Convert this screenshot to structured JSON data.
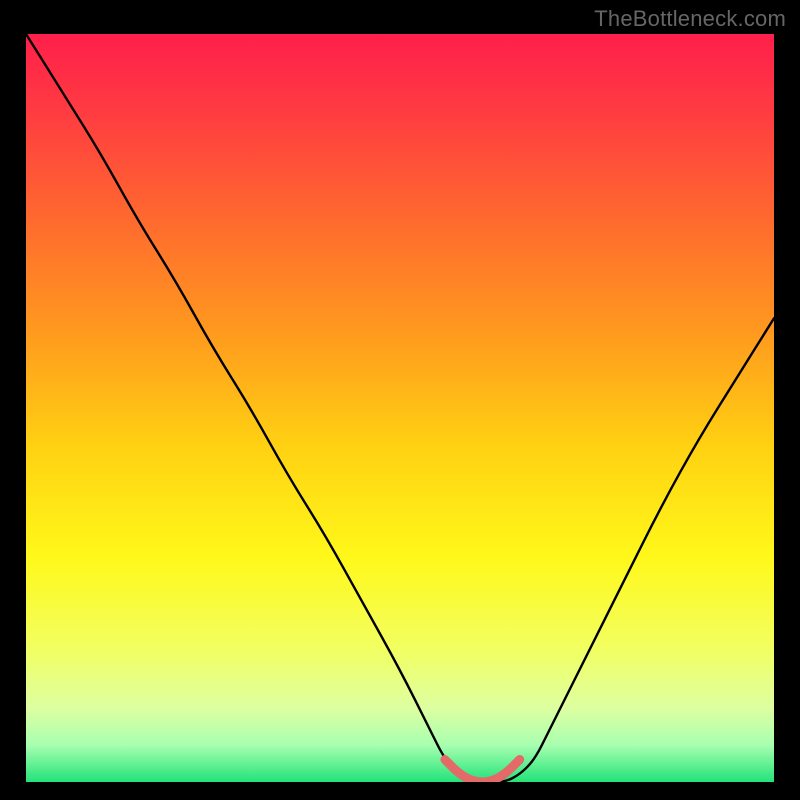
{
  "watermark": "TheBottleneck.com",
  "chart_data": {
    "type": "line",
    "title": "",
    "xlabel": "",
    "ylabel": "",
    "xlim": [
      0,
      100
    ],
    "ylim": [
      0,
      100
    ],
    "series": [
      {
        "name": "bottleneck-curve",
        "x": [
          0,
          5,
          10,
          15,
          20,
          25,
          30,
          35,
          40,
          45,
          50,
          54,
          56,
          58,
          60,
          62,
          64,
          66,
          68,
          70,
          75,
          80,
          85,
          90,
          95,
          100
        ],
        "y": [
          100,
          92,
          84,
          75,
          67,
          58,
          50,
          41,
          33,
          24,
          15,
          7,
          3,
          1,
          0,
          0,
          0,
          1,
          3,
          7,
          17,
          27,
          37,
          46,
          54,
          62
        ]
      },
      {
        "name": "flat-bottom-highlight",
        "x": [
          56,
          58,
          60,
          62,
          64,
          66
        ],
        "y": [
          3,
          1,
          0,
          0,
          1,
          3
        ]
      }
    ],
    "gradient_stops": [
      {
        "offset": 0.0,
        "color": "#ff1f4b"
      },
      {
        "offset": 0.1,
        "color": "#ff3a42"
      },
      {
        "offset": 0.25,
        "color": "#ff6a2e"
      },
      {
        "offset": 0.4,
        "color": "#ff9a1e"
      },
      {
        "offset": 0.55,
        "color": "#ffd112"
      },
      {
        "offset": 0.7,
        "color": "#fff81a"
      },
      {
        "offset": 0.82,
        "color": "#f2ff60"
      },
      {
        "offset": 0.9,
        "color": "#deffa0"
      },
      {
        "offset": 0.95,
        "color": "#a9ffb0"
      },
      {
        "offset": 1.0,
        "color": "#22e37a"
      }
    ],
    "curve_stroke": "#000000",
    "highlight_stroke": "#e46a6a"
  }
}
